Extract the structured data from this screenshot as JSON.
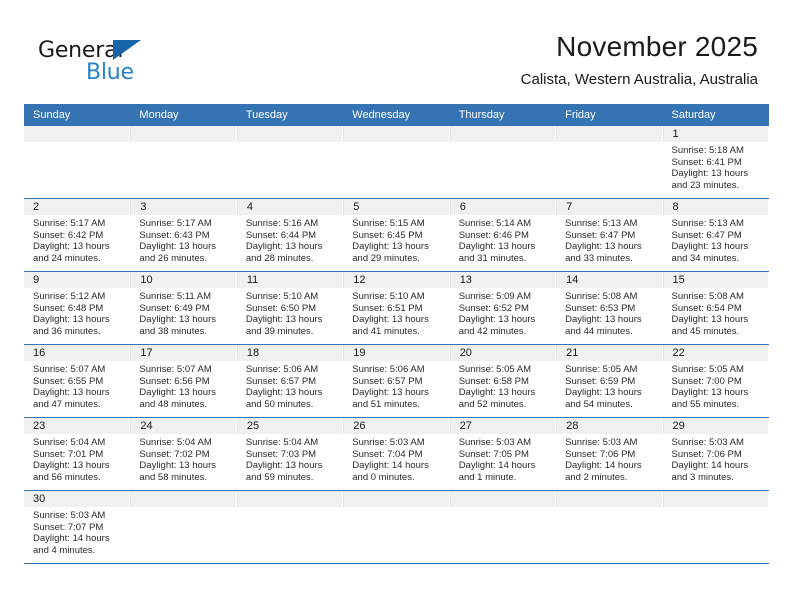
{
  "logo": {
    "line1": "General",
    "line2": "Blue",
    "triangle_icon": "blue-triangle-icon",
    "color_dark": "#1a1a1a",
    "color_blue": "#2684c6"
  },
  "header": {
    "title": "November 2025",
    "subtitle": "Calista, Western Australia, Australia"
  },
  "theme": {
    "header_blue": "#3573b2",
    "band_gray": "#f0f0f0"
  },
  "calendar": {
    "weekday_headers": [
      "Sunday",
      "Monday",
      "Tuesday",
      "Wednesday",
      "Thursday",
      "Friday",
      "Saturday"
    ],
    "weeks": [
      [
        {
          "day": "",
          "sunrise": "",
          "sunset": "",
          "daylight_line1": "",
          "daylight_line2": ""
        },
        {
          "day": "",
          "sunrise": "",
          "sunset": "",
          "daylight_line1": "",
          "daylight_line2": ""
        },
        {
          "day": "",
          "sunrise": "",
          "sunset": "",
          "daylight_line1": "",
          "daylight_line2": ""
        },
        {
          "day": "",
          "sunrise": "",
          "sunset": "",
          "daylight_line1": "",
          "daylight_line2": ""
        },
        {
          "day": "",
          "sunrise": "",
          "sunset": "",
          "daylight_line1": "",
          "daylight_line2": ""
        },
        {
          "day": "",
          "sunrise": "",
          "sunset": "",
          "daylight_line1": "",
          "daylight_line2": ""
        },
        {
          "day": "1",
          "sunrise": "Sunrise: 5:18 AM",
          "sunset": "Sunset: 6:41 PM",
          "daylight_line1": "Daylight: 13 hours",
          "daylight_line2": "and 23 minutes."
        }
      ],
      [
        {
          "day": "2",
          "sunrise": "Sunrise: 5:17 AM",
          "sunset": "Sunset: 6:42 PM",
          "daylight_line1": "Daylight: 13 hours",
          "daylight_line2": "and 24 minutes."
        },
        {
          "day": "3",
          "sunrise": "Sunrise: 5:17 AM",
          "sunset": "Sunset: 6:43 PM",
          "daylight_line1": "Daylight: 13 hours",
          "daylight_line2": "and 26 minutes."
        },
        {
          "day": "4",
          "sunrise": "Sunrise: 5:16 AM",
          "sunset": "Sunset: 6:44 PM",
          "daylight_line1": "Daylight: 13 hours",
          "daylight_line2": "and 28 minutes."
        },
        {
          "day": "5",
          "sunrise": "Sunrise: 5:15 AM",
          "sunset": "Sunset: 6:45 PM",
          "daylight_line1": "Daylight: 13 hours",
          "daylight_line2": "and 29 minutes."
        },
        {
          "day": "6",
          "sunrise": "Sunrise: 5:14 AM",
          "sunset": "Sunset: 6:46 PM",
          "daylight_line1": "Daylight: 13 hours",
          "daylight_line2": "and 31 minutes."
        },
        {
          "day": "7",
          "sunrise": "Sunrise: 5:13 AM",
          "sunset": "Sunset: 6:47 PM",
          "daylight_line1": "Daylight: 13 hours",
          "daylight_line2": "and 33 minutes."
        },
        {
          "day": "8",
          "sunrise": "Sunrise: 5:13 AM",
          "sunset": "Sunset: 6:47 PM",
          "daylight_line1": "Daylight: 13 hours",
          "daylight_line2": "and 34 minutes."
        }
      ],
      [
        {
          "day": "9",
          "sunrise": "Sunrise: 5:12 AM",
          "sunset": "Sunset: 6:48 PM",
          "daylight_line1": "Daylight: 13 hours",
          "daylight_line2": "and 36 minutes."
        },
        {
          "day": "10",
          "sunrise": "Sunrise: 5:11 AM",
          "sunset": "Sunset: 6:49 PM",
          "daylight_line1": "Daylight: 13 hours",
          "daylight_line2": "and 38 minutes."
        },
        {
          "day": "11",
          "sunrise": "Sunrise: 5:10 AM",
          "sunset": "Sunset: 6:50 PM",
          "daylight_line1": "Daylight: 13 hours",
          "daylight_line2": "and 39 minutes."
        },
        {
          "day": "12",
          "sunrise": "Sunrise: 5:10 AM",
          "sunset": "Sunset: 6:51 PM",
          "daylight_line1": "Daylight: 13 hours",
          "daylight_line2": "and 41 minutes."
        },
        {
          "day": "13",
          "sunrise": "Sunrise: 5:09 AM",
          "sunset": "Sunset: 6:52 PM",
          "daylight_line1": "Daylight: 13 hours",
          "daylight_line2": "and 42 minutes."
        },
        {
          "day": "14",
          "sunrise": "Sunrise: 5:08 AM",
          "sunset": "Sunset: 6:53 PM",
          "daylight_line1": "Daylight: 13 hours",
          "daylight_line2": "and 44 minutes."
        },
        {
          "day": "15",
          "sunrise": "Sunrise: 5:08 AM",
          "sunset": "Sunset: 6:54 PM",
          "daylight_line1": "Daylight: 13 hours",
          "daylight_line2": "and 45 minutes."
        }
      ],
      [
        {
          "day": "16",
          "sunrise": "Sunrise: 5:07 AM",
          "sunset": "Sunset: 6:55 PM",
          "daylight_line1": "Daylight: 13 hours",
          "daylight_line2": "and 47 minutes."
        },
        {
          "day": "17",
          "sunrise": "Sunrise: 5:07 AM",
          "sunset": "Sunset: 6:56 PM",
          "daylight_line1": "Daylight: 13 hours",
          "daylight_line2": "and 48 minutes."
        },
        {
          "day": "18",
          "sunrise": "Sunrise: 5:06 AM",
          "sunset": "Sunset: 6:57 PM",
          "daylight_line1": "Daylight: 13 hours",
          "daylight_line2": "and 50 minutes."
        },
        {
          "day": "19",
          "sunrise": "Sunrise: 5:06 AM",
          "sunset": "Sunset: 6:57 PM",
          "daylight_line1": "Daylight: 13 hours",
          "daylight_line2": "and 51 minutes."
        },
        {
          "day": "20",
          "sunrise": "Sunrise: 5:05 AM",
          "sunset": "Sunset: 6:58 PM",
          "daylight_line1": "Daylight: 13 hours",
          "daylight_line2": "and 52 minutes."
        },
        {
          "day": "21",
          "sunrise": "Sunrise: 5:05 AM",
          "sunset": "Sunset: 6:59 PM",
          "daylight_line1": "Daylight: 13 hours",
          "daylight_line2": "and 54 minutes."
        },
        {
          "day": "22",
          "sunrise": "Sunrise: 5:05 AM",
          "sunset": "Sunset: 7:00 PM",
          "daylight_line1": "Daylight: 13 hours",
          "daylight_line2": "and 55 minutes."
        }
      ],
      [
        {
          "day": "23",
          "sunrise": "Sunrise: 5:04 AM",
          "sunset": "Sunset: 7:01 PM",
          "daylight_line1": "Daylight: 13 hours",
          "daylight_line2": "and 56 minutes."
        },
        {
          "day": "24",
          "sunrise": "Sunrise: 5:04 AM",
          "sunset": "Sunset: 7:02 PM",
          "daylight_line1": "Daylight: 13 hours",
          "daylight_line2": "and 58 minutes."
        },
        {
          "day": "25",
          "sunrise": "Sunrise: 5:04 AM",
          "sunset": "Sunset: 7:03 PM",
          "daylight_line1": "Daylight: 13 hours",
          "daylight_line2": "and 59 minutes."
        },
        {
          "day": "26",
          "sunrise": "Sunrise: 5:03 AM",
          "sunset": "Sunset: 7:04 PM",
          "daylight_line1": "Daylight: 14 hours",
          "daylight_line2": "and 0 minutes."
        },
        {
          "day": "27",
          "sunrise": "Sunrise: 5:03 AM",
          "sunset": "Sunset: 7:05 PM",
          "daylight_line1": "Daylight: 14 hours",
          "daylight_line2": "and 1 minute."
        },
        {
          "day": "28",
          "sunrise": "Sunrise: 5:03 AM",
          "sunset": "Sunset: 7:06 PM",
          "daylight_line1": "Daylight: 14 hours",
          "daylight_line2": "and 2 minutes."
        },
        {
          "day": "29",
          "sunrise": "Sunrise: 5:03 AM",
          "sunset": "Sunset: 7:06 PM",
          "daylight_line1": "Daylight: 14 hours",
          "daylight_line2": "and 3 minutes."
        }
      ],
      [
        {
          "day": "30",
          "sunrise": "Sunrise: 5:03 AM",
          "sunset": "Sunset: 7:07 PM",
          "daylight_line1": "Daylight: 14 hours",
          "daylight_line2": "and 4 minutes."
        },
        {
          "day": "",
          "sunrise": "",
          "sunset": "",
          "daylight_line1": "",
          "daylight_line2": ""
        },
        {
          "day": "",
          "sunrise": "",
          "sunset": "",
          "daylight_line1": "",
          "daylight_line2": ""
        },
        {
          "day": "",
          "sunrise": "",
          "sunset": "",
          "daylight_line1": "",
          "daylight_line2": ""
        },
        {
          "day": "",
          "sunrise": "",
          "sunset": "",
          "daylight_line1": "",
          "daylight_line2": ""
        },
        {
          "day": "",
          "sunrise": "",
          "sunset": "",
          "daylight_line1": "",
          "daylight_line2": ""
        },
        {
          "day": "",
          "sunrise": "",
          "sunset": "",
          "daylight_line1": "",
          "daylight_line2": ""
        }
      ]
    ]
  }
}
